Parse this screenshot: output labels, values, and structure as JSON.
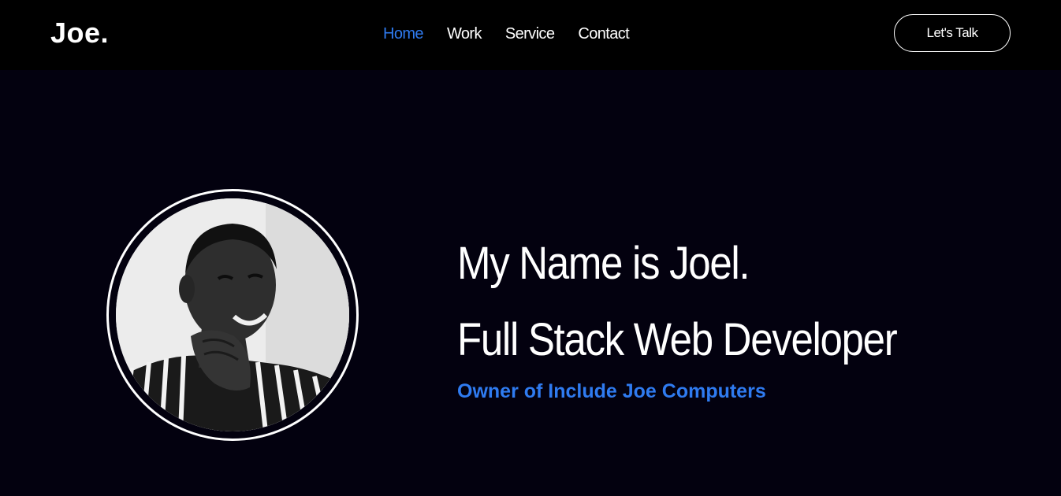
{
  "brand": {
    "logo": "Joe."
  },
  "nav": {
    "items": [
      {
        "label": "Home",
        "active": true
      },
      {
        "label": "Work",
        "active": false
      },
      {
        "label": "Service",
        "active": false
      },
      {
        "label": "Contact",
        "active": false
      }
    ],
    "cta_label": "Let's Talk"
  },
  "hero": {
    "line1": "My Name is Joel.",
    "line2": "Full Stack Web Developer",
    "subtitle": "Owner of Include Joe Computers",
    "avatar_icon": "profile-photo"
  },
  "colors": {
    "accent": "#2f7bf0",
    "background": "#03010f",
    "navbar": "#000000",
    "text": "#ffffff"
  }
}
